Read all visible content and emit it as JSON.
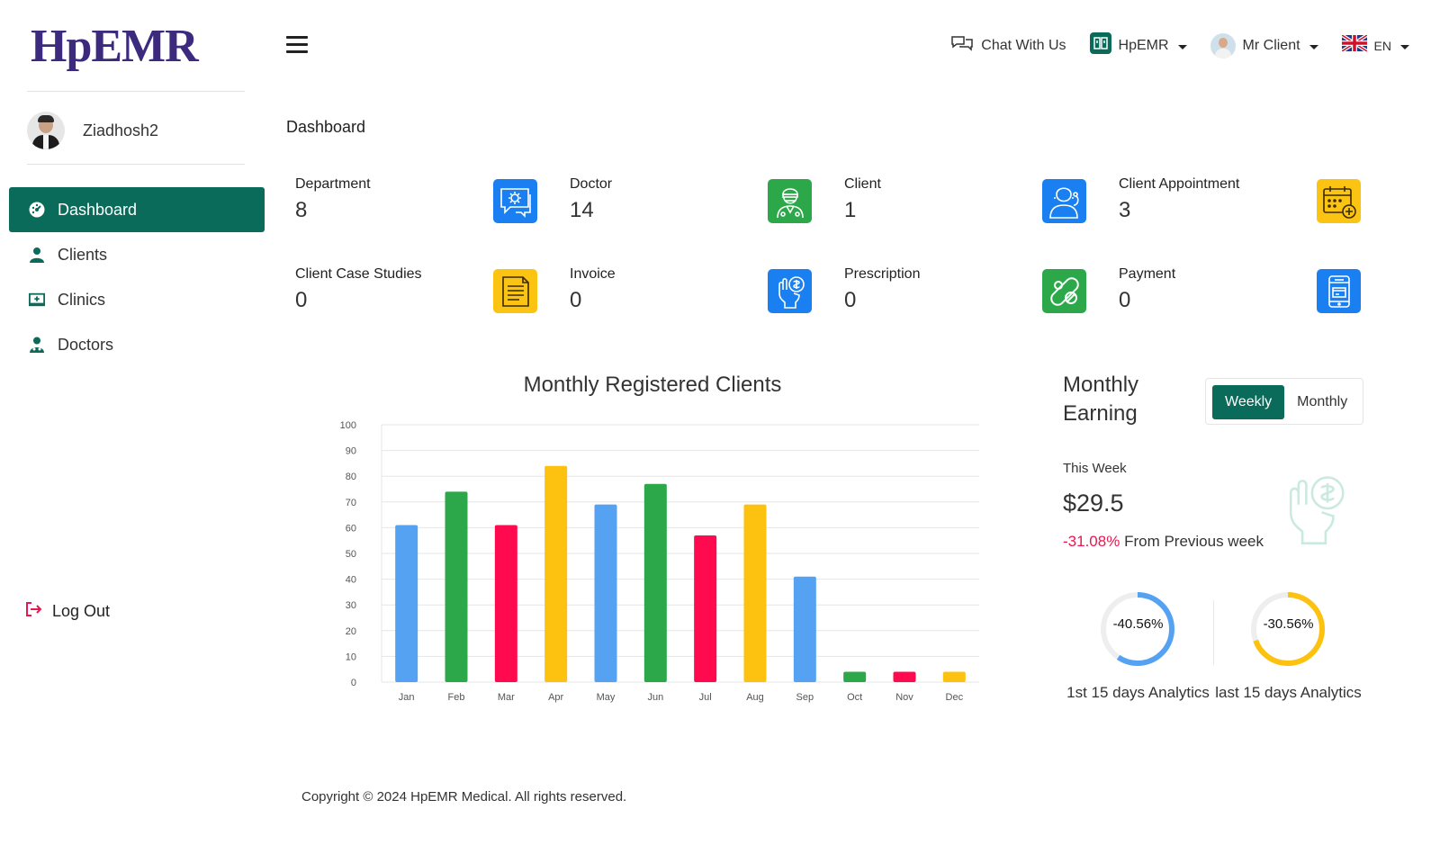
{
  "brand": {
    "logo": "HpEMR"
  },
  "user": {
    "name": "Ziadhosh2"
  },
  "nav": {
    "items": [
      {
        "label": "Dashboard",
        "icon": "dashboard-icon",
        "active": true
      },
      {
        "label": "Clients",
        "icon": "user-icon",
        "active": false
      },
      {
        "label": "Clinics",
        "icon": "clinic-icon",
        "active": false
      },
      {
        "label": "Doctors",
        "icon": "doctor-icon",
        "active": false
      }
    ],
    "logout": "Log Out"
  },
  "header": {
    "chat": "Chat With Us",
    "org": "HpEMR",
    "account": "Mr Client",
    "lang": "EN"
  },
  "page": {
    "title": "Dashboard"
  },
  "stats": [
    {
      "label": "Department",
      "value": "8",
      "color": "#1a7ff0",
      "icon": "department-icon"
    },
    {
      "label": "Doctor",
      "value": "14",
      "color": "#2ca84a",
      "icon": "doctor-icon"
    },
    {
      "label": "Client",
      "value": "1",
      "color": "#1a7ff0",
      "icon": "client-icon"
    },
    {
      "label": "Client Appointment",
      "value": "3",
      "color": "#fbc312",
      "icon": "appointment-icon"
    },
    {
      "label": "Client Case Studies",
      "value": "0",
      "color": "#fbc312",
      "icon": "case-study-icon"
    },
    {
      "label": "Invoice",
      "value": "0",
      "color": "#1a7ff0",
      "icon": "invoice-icon"
    },
    {
      "label": "Prescription",
      "value": "0",
      "color": "#2ca84a",
      "icon": "prescription-icon"
    },
    {
      "label": "Payment",
      "value": "0",
      "color": "#1a7ff0",
      "icon": "payment-icon"
    }
  ],
  "chart_data": {
    "type": "bar",
    "title": "Monthly Registered Clients",
    "categories": [
      "Jan",
      "Feb",
      "Mar",
      "Apr",
      "May",
      "Jun",
      "Jul",
      "Aug",
      "Sep",
      "Oct",
      "Nov",
      "Dec"
    ],
    "values": [
      61,
      74,
      61,
      84,
      69,
      77,
      57,
      69,
      41,
      4,
      4,
      4
    ],
    "colors": [
      "#55a2f3",
      "#2ca84a",
      "#ff0a4f",
      "#fdc10f",
      "#55a2f3",
      "#2ca84a",
      "#ff0a4f",
      "#fdc10f",
      "#55a2f3",
      "#2ca84a",
      "#ff0a4f",
      "#fdc10f"
    ],
    "ylim": [
      0,
      100
    ],
    "yticks": [
      0,
      10,
      20,
      30,
      40,
      50,
      60,
      70,
      80,
      90,
      100
    ],
    "grid": true,
    "xlabel": "",
    "ylabel": ""
  },
  "earning": {
    "title": "Monthly Earning",
    "toggle": {
      "weekly": "Weekly",
      "monthly": "Monthly",
      "selected": "Weekly"
    },
    "period_label": "This Week",
    "amount": "$29.5",
    "change": "-31.08%",
    "change_suffix": "From Previous week",
    "rings": [
      {
        "pct_label": "-40.56%",
        "value": 40.56,
        "color": "#55a2f3",
        "caption": "1st 15 days Analytics"
      },
      {
        "pct_label": "-30.56%",
        "value": 30.56,
        "color": "#fdc10f",
        "caption": "last 15 days Analytics"
      }
    ]
  },
  "footer": {
    "text": "Copyright © 2024 HpEMR Medical. All rights reserved."
  }
}
